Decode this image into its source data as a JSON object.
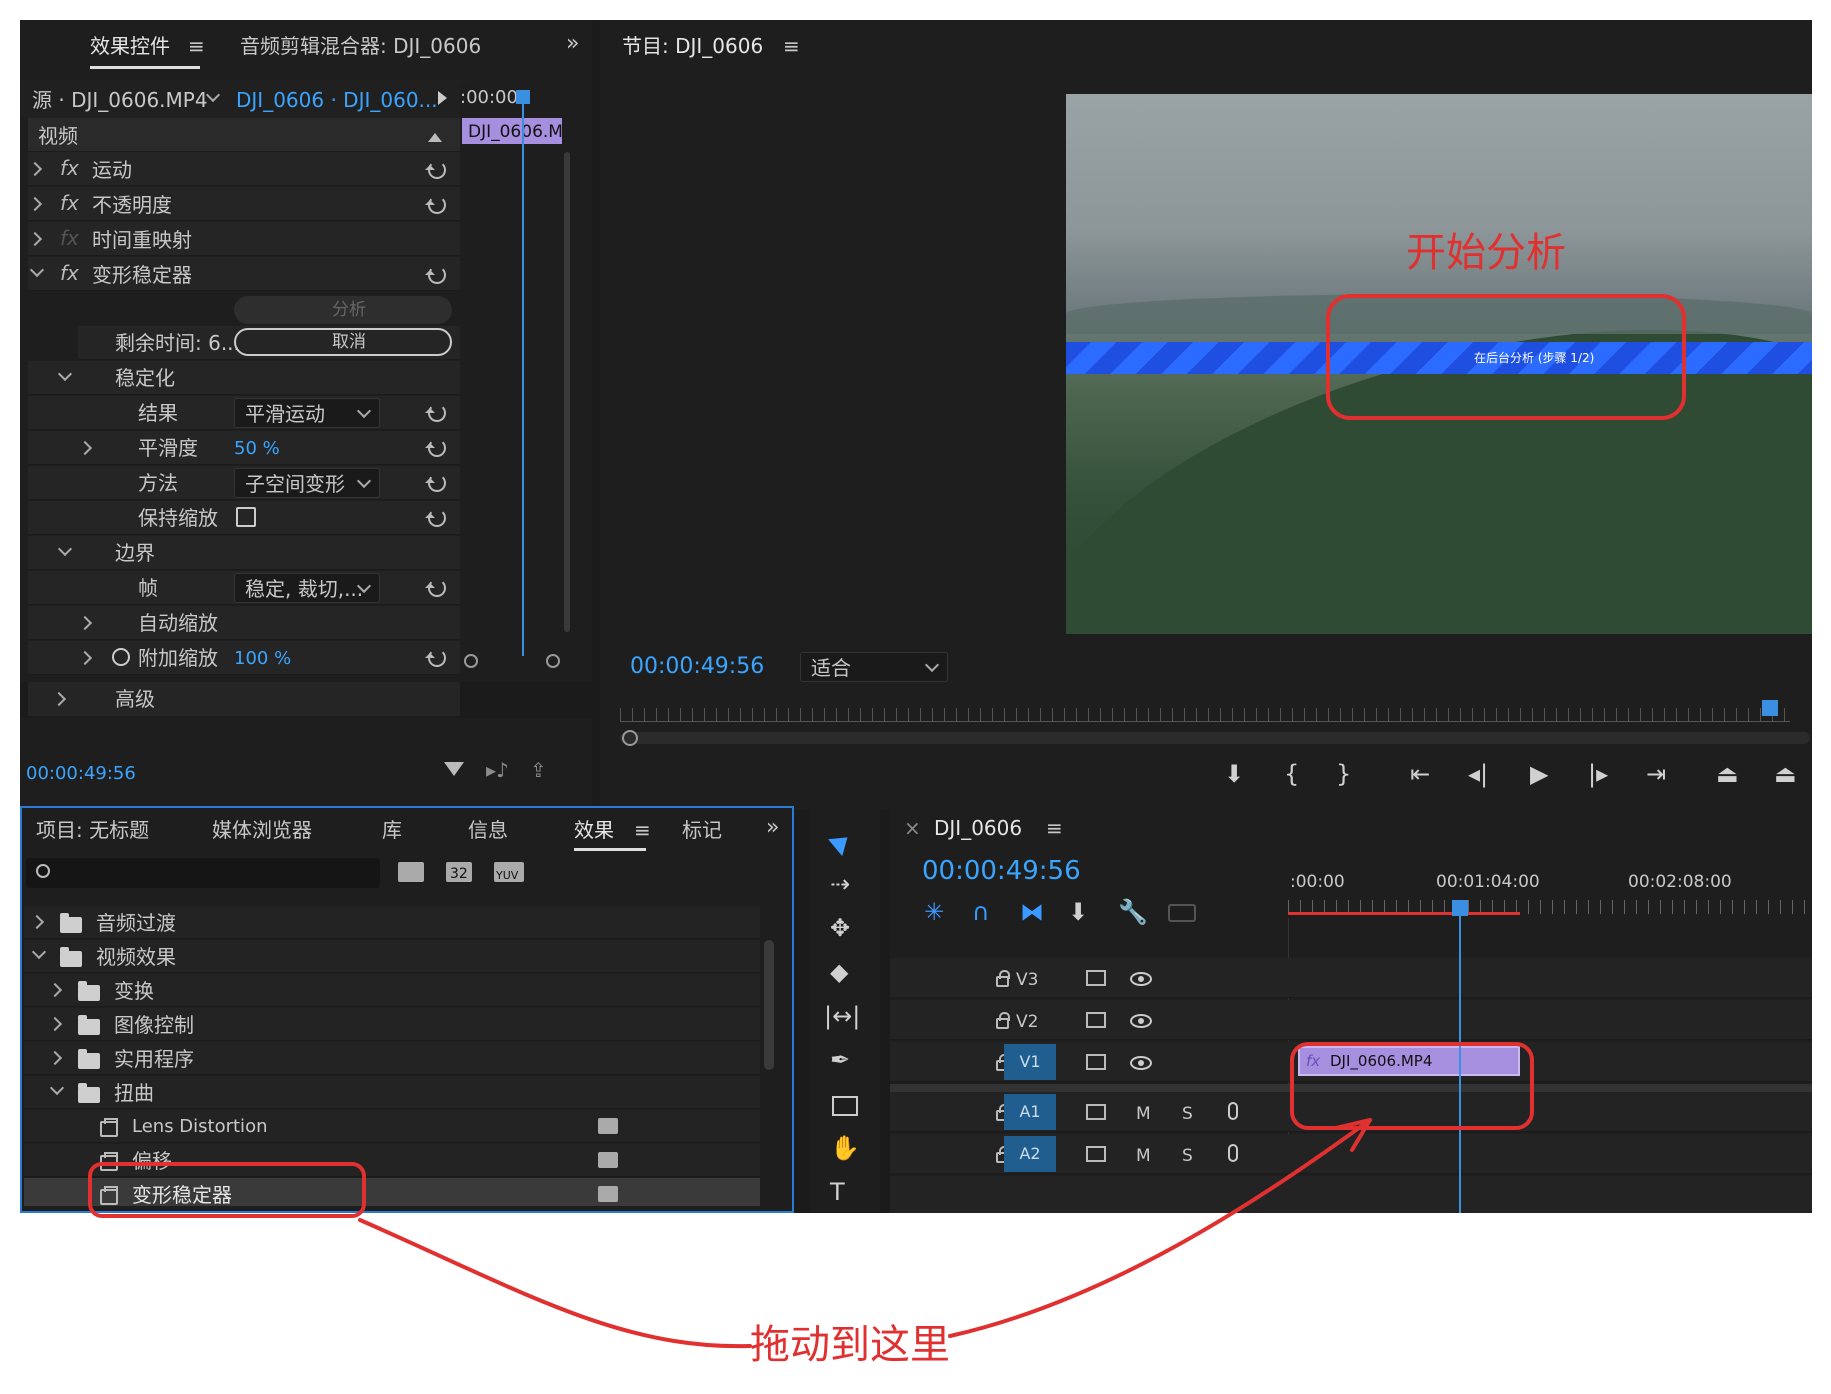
{
  "effect_controls": {
    "tabs": [
      {
        "label": "效果控件"
      },
      {
        "label": "音频剪辑混合器: DJI_0606"
      }
    ],
    "source_label": "源 · DJI_0606.MP4",
    "sequence_label": "DJI_0606 · DJI_060...",
    "timeline_time": ":00:00",
    "clip_label": "DJI_0606.M",
    "section_video": "视频",
    "effects": {
      "motion": "运动",
      "opacity": "不透明度",
      "time_remap": "时间重映射",
      "warp_stabilizer": "变形稳定器"
    },
    "analyze_button": "分析",
    "remaining_label": "剩余时间: 6...",
    "cancel_button": "取消",
    "stabilization": "稳定化",
    "result_label": "结果",
    "result_value": "平滑运动",
    "smoothness_label": "平滑度",
    "smoothness_value": "50 %",
    "method_label": "方法",
    "method_value": "子空间变形",
    "preserve_scale_label": "保持缩放",
    "borders": "边界",
    "framing_label": "帧",
    "framing_value": "稳定, 裁切,...",
    "auto_scale_label": "自动缩放",
    "additional_scale_label": "附加缩放",
    "additional_scale_value": "100 %",
    "advanced_label": "高级",
    "current_time": "00:00:49:56",
    "fx_glyph": "fx"
  },
  "program_monitor": {
    "title": "节目: DJI_0606",
    "timecode": "00:00:49:56",
    "fit_value": "适合",
    "analysis_banner": "在后台分析 (步骤 1/2)"
  },
  "project_panel": {
    "tabs": [
      {
        "label": "项目: 无标题"
      },
      {
        "label": "媒体浏览器"
      },
      {
        "label": "库"
      },
      {
        "label": "信息"
      },
      {
        "label": "效果"
      },
      {
        "label": "标记"
      }
    ],
    "badges": [
      "32",
      "YUV"
    ],
    "tree": [
      {
        "label": "音频过渡",
        "level": 0,
        "expanded": false,
        "type": "folder"
      },
      {
        "label": "视频效果",
        "level": 0,
        "expanded": true,
        "type": "folder"
      },
      {
        "label": "变换",
        "level": 1,
        "expanded": false,
        "type": "folder"
      },
      {
        "label": "图像控制",
        "level": 1,
        "expanded": false,
        "type": "folder"
      },
      {
        "label": "实用程序",
        "level": 1,
        "expanded": false,
        "type": "folder"
      },
      {
        "label": "扭曲",
        "level": 1,
        "expanded": true,
        "type": "folder"
      },
      {
        "label": "Lens Distortion",
        "level": 2,
        "type": "effect"
      },
      {
        "label": "偏移",
        "level": 2,
        "type": "effect"
      },
      {
        "label": "变形稳定器",
        "level": 2,
        "type": "effect",
        "selected": true
      }
    ]
  },
  "timeline": {
    "title": "DJI_0606",
    "timecode": "00:00:49:56",
    "ruler_labels": [
      ":00:00",
      "00:01:04:00",
      "00:02:08:00"
    ],
    "tracks": [
      {
        "name": "V3",
        "kind": "video"
      },
      {
        "name": "V2",
        "kind": "video"
      },
      {
        "name": "V1",
        "kind": "video",
        "active": true
      },
      {
        "name": "A1",
        "kind": "audio"
      },
      {
        "name": "A2",
        "kind": "audio"
      }
    ],
    "mute_label": "M",
    "solo_label": "S",
    "clip_name": "DJI_0606.MP4"
  },
  "annotations": {
    "start_analysis": "开始分析",
    "drag_here": "拖动到这里"
  },
  "colors": {
    "accent_blue": "#3aa5ff",
    "annotation_red": "#e03030",
    "clip_purple": "#a68fdf"
  }
}
